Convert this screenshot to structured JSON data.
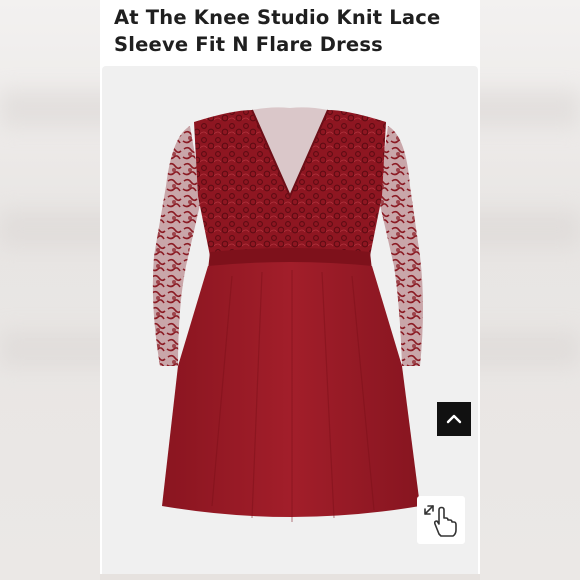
{
  "product": {
    "title": "At The Knee Studio Knit Lace Sleeve Fit N Flare Dress",
    "image_alt": "Red lace sleeve fit and flare dress",
    "dress_color": "#9b1b26",
    "lace_color": "#7d111b"
  },
  "controls": {
    "back_to_top_icon": "chevron-up-icon",
    "zoom_icon": "tap-to-zoom-icon"
  }
}
